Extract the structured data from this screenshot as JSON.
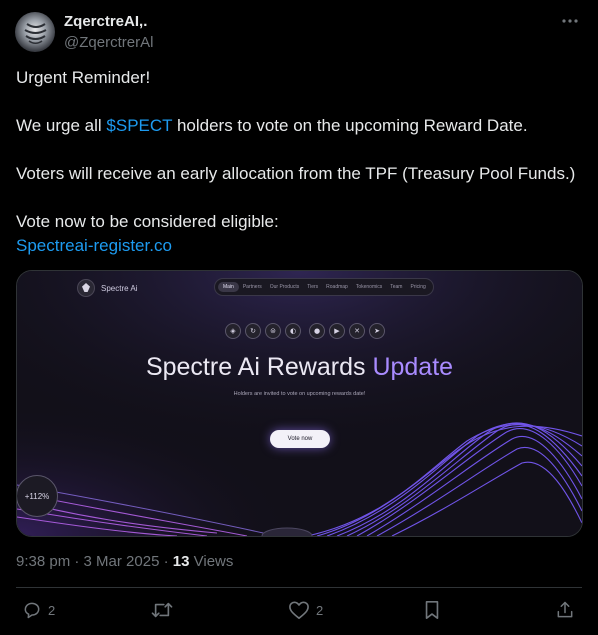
{
  "author": {
    "display_name": "ZqerctreAI,.",
    "handle": "@ZqerctrerAl"
  },
  "tweet": {
    "line1": "Urgent Reminder!",
    "line2_pre": "We urge all ",
    "cashtag": "$SPECT",
    "line2_post": " holders to vote on the upcoming Reward Date.",
    "line3": "Voters will receive an early allocation from the TPF (Treasury Pool Funds.)",
    "line4": "Vote now to be considered eligible:",
    "link": "Spectreai-register.co"
  },
  "media": {
    "brand": "Spectre Ai",
    "nav": [
      "Main",
      "Partners",
      "Our Products",
      "Tiers",
      "Roadmap",
      "Tokenomics",
      "Team",
      "Pricing"
    ],
    "headline_main": "Spectre Ai Rewards ",
    "headline_accent": "Update",
    "subline": "Holders are invited to vote on upcoming rewards date!",
    "button": "Vote now",
    "badge": "+112%",
    "social_icons_left": [
      "bot-icon",
      "refresh-icon",
      "web-icon",
      "chart-icon"
    ],
    "social_icons_right": [
      "medium-icon",
      "youtube-icon",
      "x-icon",
      "telegram-icon"
    ]
  },
  "meta": {
    "time": "9:38 pm",
    "date": "3 Mar 2025",
    "views_count": "13",
    "views_label": "Views"
  },
  "actions": {
    "replies": "2",
    "likes": "2"
  },
  "colors": {
    "background": "#000000",
    "text": "#e7e9ea",
    "muted": "#71767b",
    "link": "#1d9bf0",
    "accent_purple": "#a98bff"
  }
}
